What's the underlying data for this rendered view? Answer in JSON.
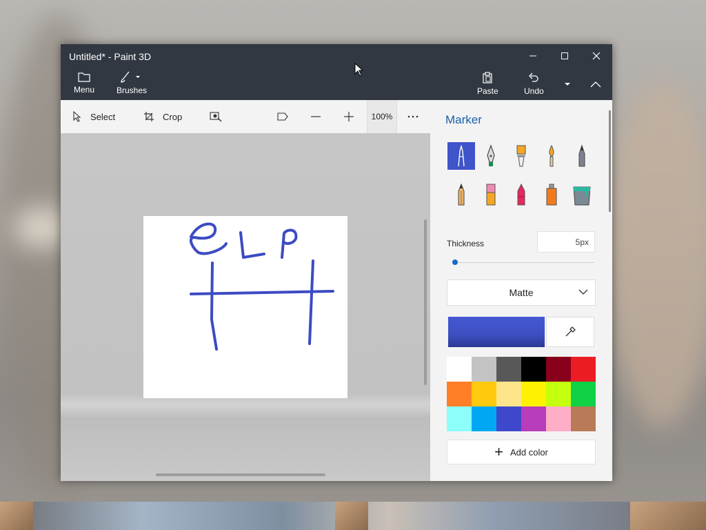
{
  "window": {
    "title": "Untitled* - Paint 3D"
  },
  "titlebar": {
    "menu_label": "Menu",
    "brushes_label": "Brushes",
    "paste_label": "Paste",
    "undo_label": "Undo"
  },
  "toolbar": {
    "select_label": "Select",
    "crop_label": "Crop",
    "zoom_level": "100%"
  },
  "panel": {
    "title": "Marker",
    "thickness_label": "Thickness",
    "thickness_value": "5px",
    "thickness_fraction": 0.02,
    "finish_value": "Matte",
    "current_color": "#3f51c8",
    "add_color_label": "Add color",
    "brushes": [
      "marker",
      "calligraphy-pen",
      "oil-brush",
      "watercolor",
      "pixel-pen",
      "pencil",
      "eraser",
      "crayon",
      "spray-can",
      "fill"
    ],
    "palette": [
      "#ffffff",
      "#c3c3c3",
      "#585858",
      "#000000",
      "#88001b",
      "#ec1c24",
      "#ff7f27",
      "#ffc90e",
      "#fde68a",
      "#fff200",
      "#c4ff0e",
      "#0ed145",
      "#8cfffb",
      "#00a8f3",
      "#3f48cc",
      "#b83dba",
      "#ffaec8",
      "#b97a57"
    ]
  }
}
